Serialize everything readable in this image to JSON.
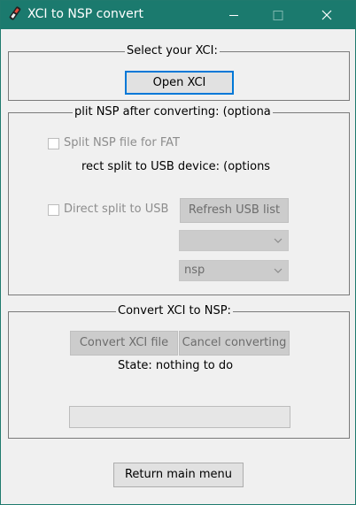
{
  "window": {
    "title": "XCI to NSP convert"
  },
  "titlebar": {
    "icon": "app-icon",
    "minimize_icon": "minimize-icon",
    "maximize_icon": "maximize-icon",
    "close_icon": "close-icon"
  },
  "select_group": {
    "legend": "Select your XCI:",
    "open_button": "Open XCI"
  },
  "split_group": {
    "legend": "plit NSP after converting: (optiona",
    "split_fat_label": "Split NSP file for FAT",
    "usb_heading": "rect split to USB device: (options",
    "direct_split_label": "Direct split to USB",
    "refresh_button": "Refresh USB list",
    "usb_device_select": "",
    "format_select": "nsp"
  },
  "convert_group": {
    "legend": "Convert XCI to NSP:",
    "convert_button": "Convert XCI file",
    "cancel_button": "Cancel converting",
    "state_text": "State: nothing to do",
    "progress": 0
  },
  "footer": {
    "return_button": "Return main menu"
  }
}
